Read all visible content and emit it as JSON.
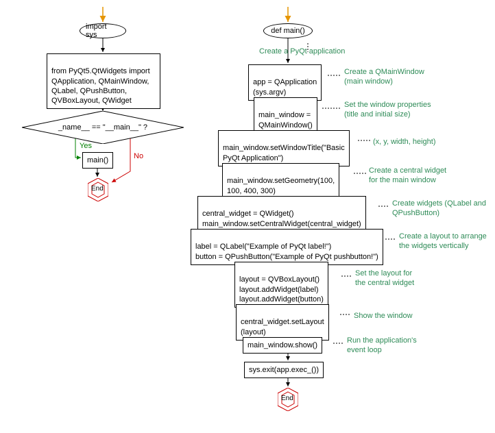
{
  "chart_data": [
    {
      "type": "flowchart",
      "title": "left",
      "nodes": [
        {
          "id": "l_start_arrow",
          "kind": "start-arrow"
        },
        {
          "id": "l_import",
          "kind": "ellipse",
          "label": "import sys"
        },
        {
          "id": "l_from",
          "kind": "box",
          "label": "from PyQt5.QtWidgets import\nQApplication, QMainWindow,\nQLabel, QPushButton,\nQVBoxLayout, QWidget"
        },
        {
          "id": "l_decision",
          "kind": "diamond",
          "label": "_name__ == \"__main__\"  ?"
        },
        {
          "id": "l_main",
          "kind": "box",
          "label": "main()"
        },
        {
          "id": "l_end",
          "kind": "end"
        }
      ],
      "edges": [
        {
          "from": "l_start_arrow",
          "to": "l_import"
        },
        {
          "from": "l_import",
          "to": "l_from"
        },
        {
          "from": "l_from",
          "to": "l_decision"
        },
        {
          "from": "l_decision",
          "to": "l_main",
          "label": "Yes",
          "color": "green"
        },
        {
          "from": "l_decision",
          "to": "l_end",
          "label": "No",
          "color": "red"
        },
        {
          "from": "l_main",
          "to": "l_end"
        }
      ]
    },
    {
      "type": "flowchart",
      "title": "right",
      "nodes": [
        {
          "id": "r_start_arrow",
          "kind": "start-arrow"
        },
        {
          "id": "r_def",
          "kind": "ellipse",
          "label": "def main()"
        },
        {
          "id": "r_app",
          "kind": "box",
          "label": "app = QApplication\n(sys.argv)",
          "comment": "Create a QMainWindow\n(main window)"
        },
        {
          "id": "r_mw",
          "kind": "box",
          "label": "main_window =\nQMainWindow()",
          "comment": "Set the window properties\n(title and initial size)"
        },
        {
          "id": "r_title",
          "kind": "box",
          "label": "main_window.setWindowTitle(\"Basic\nPyQt Application\")",
          "comment": "(x, y, width, height)"
        },
        {
          "id": "r_geom",
          "kind": "box",
          "label": "main_window.setGeometry(100,\n100, 400, 300)",
          "comment": "Create a central widget\nfor the main window"
        },
        {
          "id": "r_central",
          "kind": "box",
          "label": "central_widget = QWidget()\nmain_window.setCentralWidget(central_widget)",
          "comment": "Create widgets (QLabel and\nQPushButton)"
        },
        {
          "id": "r_labels",
          "kind": "box",
          "label": "label = QLabel(\"Example of PyQt label!\")\nbutton = QPushButton(\"Example of PyQt pushbutton!\")",
          "comment": "Create a layout to arrange\nthe widgets vertically"
        },
        {
          "id": "r_layout",
          "kind": "box",
          "label": "layout = QVBoxLayout()\nlayout.addWidget(label)\nlayout.addWidget(button)",
          "comment": "Set the layout for\nthe central widget"
        },
        {
          "id": "r_setlayout",
          "kind": "box",
          "label": "central_widget.setLayout\n(layout)",
          "comment": "Show the window"
        },
        {
          "id": "r_show",
          "kind": "box",
          "label": "main_window.show()",
          "comment": "Run the application's\nevent loop"
        },
        {
          "id": "r_exit",
          "kind": "box",
          "label": "sys.exit(app.exec_())"
        },
        {
          "id": "r_end",
          "kind": "end"
        }
      ],
      "top_comment": "Create a PyQt application",
      "edges": [
        {
          "from": "r_start_arrow",
          "to": "r_def"
        },
        {
          "from": "r_def",
          "to": "r_app"
        },
        {
          "from": "r_app",
          "to": "r_mw"
        },
        {
          "from": "r_mw",
          "to": "r_title"
        },
        {
          "from": "r_title",
          "to": "r_geom"
        },
        {
          "from": "r_geom",
          "to": "r_central"
        },
        {
          "from": "r_central",
          "to": "r_labels"
        },
        {
          "from": "r_labels",
          "to": "r_layout"
        },
        {
          "from": "r_layout",
          "to": "r_setlayout"
        },
        {
          "from": "r_setlayout",
          "to": "r_show"
        },
        {
          "from": "r_show",
          "to": "r_exit"
        },
        {
          "from": "r_exit",
          "to": "r_end"
        }
      ]
    }
  ],
  "labels": {
    "import_sys": "import sys",
    "from_import": "from PyQt5.QtWidgets import\nQApplication, QMainWindow,\nQLabel, QPushButton,\nQVBoxLayout, QWidget",
    "decision": "_name__ == \"__main__\"  ?",
    "main_call": "main()",
    "end": "End",
    "yes": "Yes",
    "no": "No",
    "def_main": "def main()",
    "top_comment": "Create a PyQt application",
    "r_app": "app = QApplication\n(sys.argv)",
    "r_app_c": "Create a QMainWindow\n(main window)",
    "r_mw": "main_window =\nQMainWindow()",
    "r_mw_c": "Set the window properties\n(title and initial size)",
    "r_title": "main_window.setWindowTitle(\"Basic\nPyQt Application\")",
    "r_title_c": "(x, y, width, height)",
    "r_geom": "main_window.setGeometry(100,\n100, 400, 300)",
    "r_geom_c": "Create a central widget\nfor the main window",
    "r_central": "central_widget = QWidget()\nmain_window.setCentralWidget(central_widget)",
    "r_central_c": "Create widgets (QLabel and\nQPushButton)",
    "r_labels": "label = QLabel(\"Example of PyQt label!\")\nbutton = QPushButton(\"Example of PyQt pushbutton!\")",
    "r_labels_c": "Create a layout to arrange\nthe widgets vertically",
    "r_layout": "layout = QVBoxLayout()\nlayout.addWidget(label)\nlayout.addWidget(button)",
    "r_layout_c": "Set the layout for\nthe central widget",
    "r_setlayout": "central_widget.setLayout\n(layout)",
    "r_setlayout_c": "Show the window",
    "r_show": "main_window.show()",
    "r_show_c": "Run the application's\nevent loop",
    "r_exit": "sys.exit(app.exec_())"
  }
}
